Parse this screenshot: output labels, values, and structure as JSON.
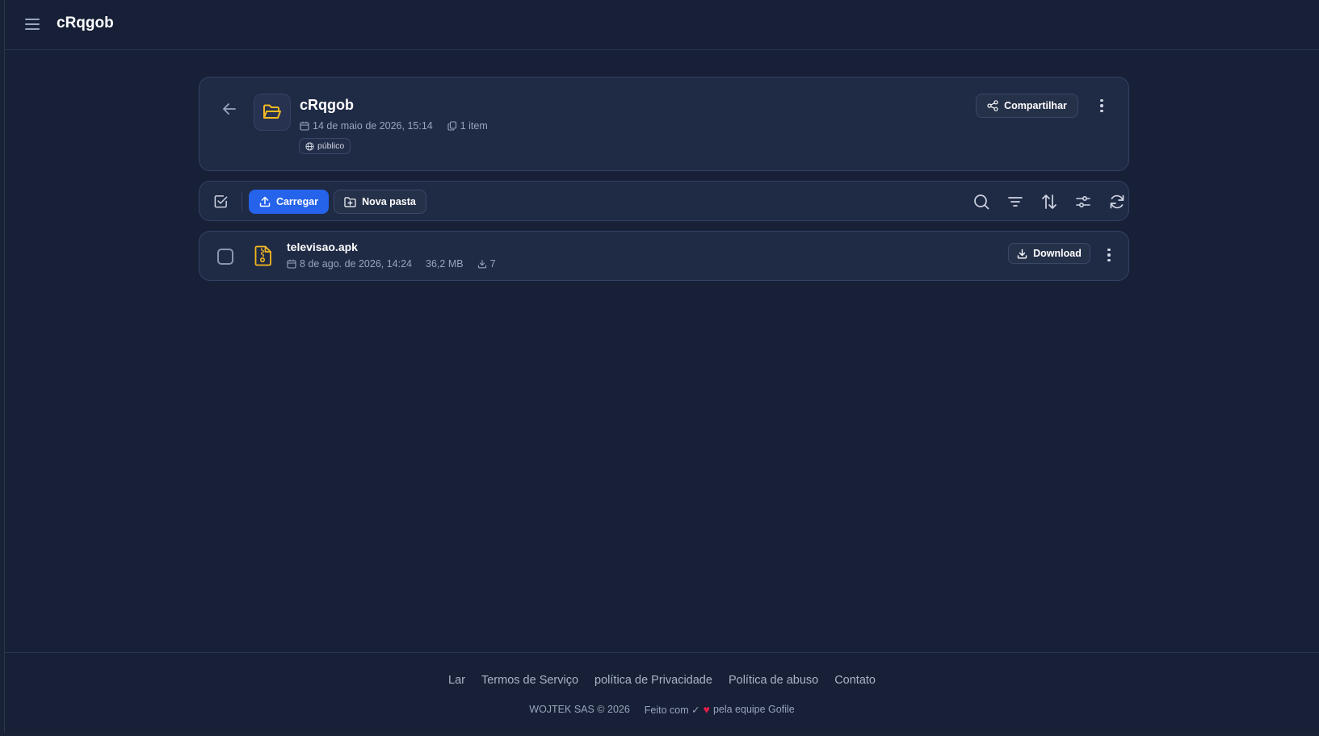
{
  "topbar": {
    "title": "cRqgob"
  },
  "folder": {
    "name": "cRqgob",
    "date": "14 de maio de 2026, 15:14",
    "item_count": "1 item",
    "visibility": "público",
    "share_label": "Compartilhar"
  },
  "toolbar": {
    "upload_label": "Carregar",
    "new_folder_label": "Nova pasta"
  },
  "files": [
    {
      "name": "televisao.apk",
      "date": "8 de ago. de 2026, 14:24",
      "size": "36,2 MB",
      "downloads": "7",
      "download_label": "Download"
    }
  ],
  "footer": {
    "links": [
      "Lar",
      "Termos de Serviço",
      "política de Privacidade",
      "Política de abuso",
      "Contato"
    ],
    "copyright": "WOJTEK SAS © 2026",
    "made_with_prefix": "Feito com ✓",
    "made_with_suffix": "pela equipe Gofile"
  },
  "colors": {
    "background": "#172036",
    "card": "#1f2a45",
    "accent": "#2563eb",
    "folder_icon": "#f5b921"
  }
}
